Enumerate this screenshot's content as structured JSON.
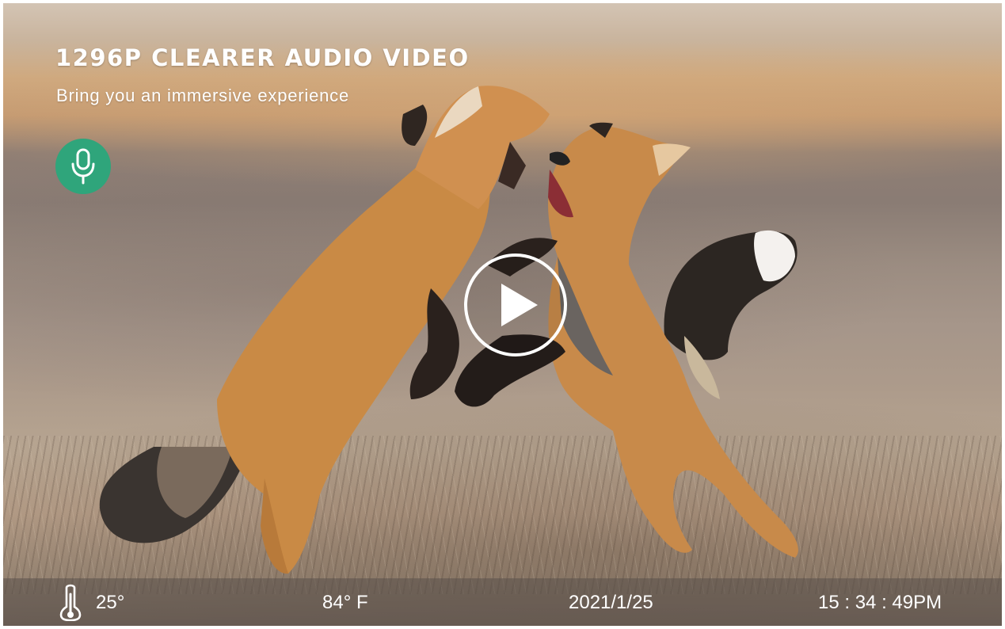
{
  "overlay": {
    "headline": "1296P CLEARER AUDIO VIDEO",
    "subheadline": "Bring you an immersive experience",
    "mic_icon": "microphone-icon",
    "play_icon": "play-icon"
  },
  "status_bar": {
    "temperature_icon": "thermometer-icon",
    "temperature_c": "25°",
    "temperature_f": "84° F",
    "date": "2021/1/25",
    "time": "15 : 34 : 49PM"
  },
  "colors": {
    "mic_badge": "#2fa57b",
    "overlay_text": "#ffffff",
    "status_bar_background": "#5a504b"
  }
}
